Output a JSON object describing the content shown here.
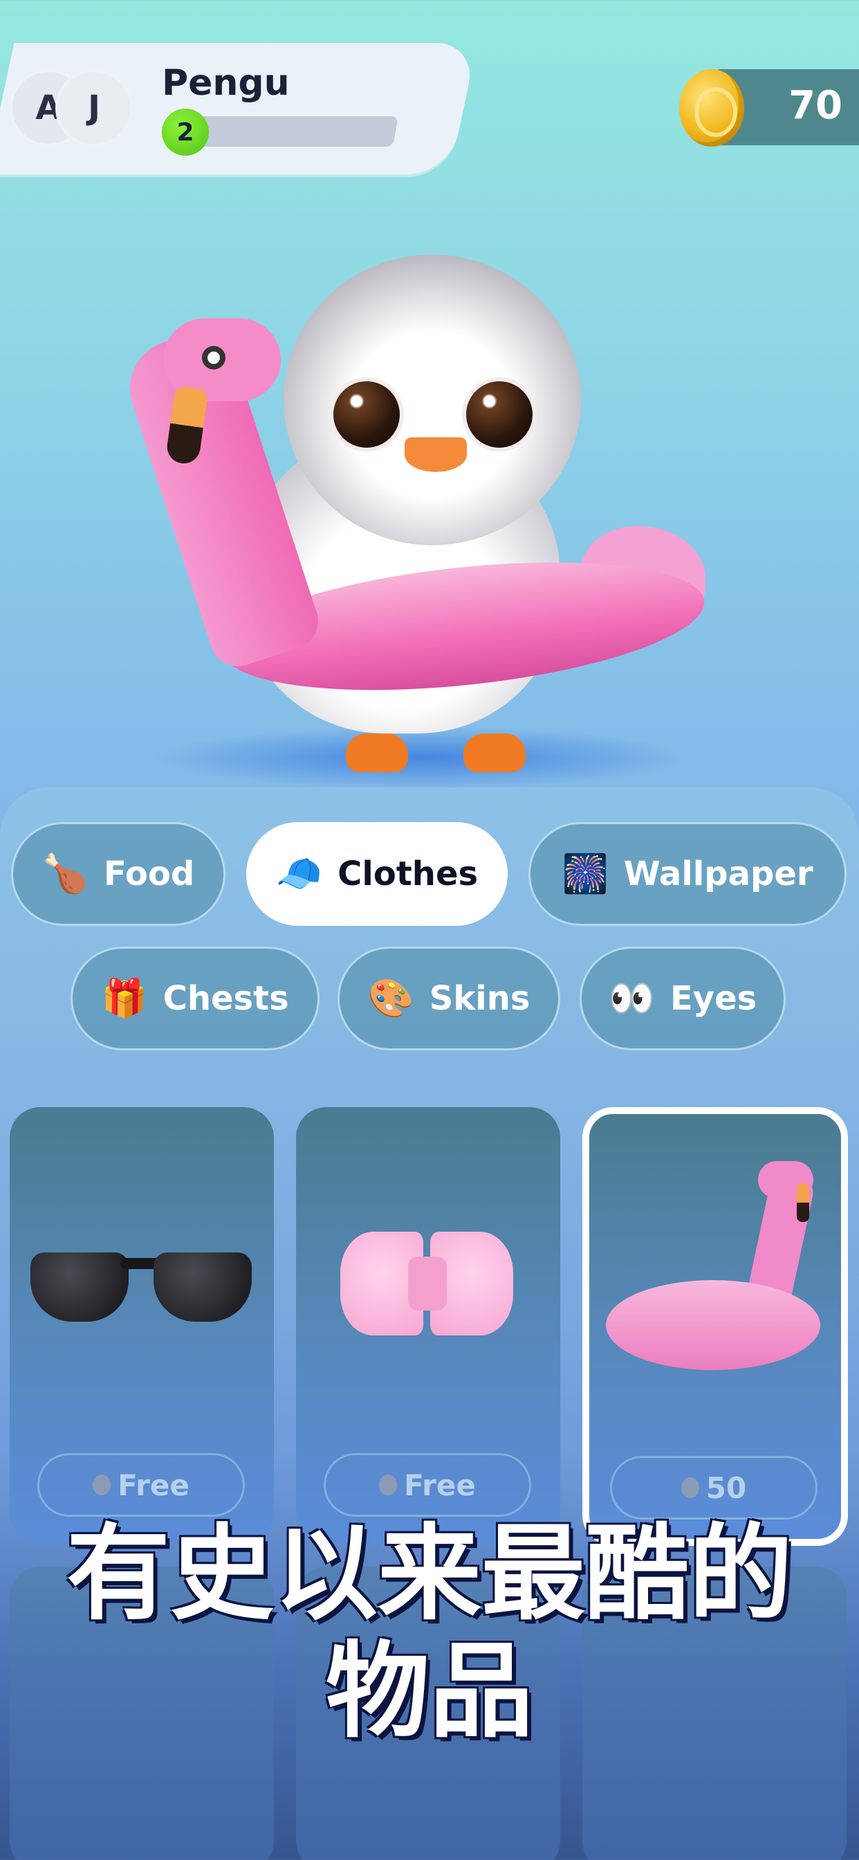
{
  "header": {
    "avatars": [
      "A",
      "J"
    ],
    "username": "Pengu",
    "level": "2",
    "xp_progress": 0.12,
    "coins": "70"
  },
  "categories": [
    {
      "label": "Food",
      "icon": "drumstick-icon",
      "glyph": "🍗",
      "active": false
    },
    {
      "label": "Clothes",
      "icon": "cap-icon",
      "glyph": "🧢",
      "active": true
    },
    {
      "label": "Wallpaper",
      "icon": "fireworks-icon",
      "glyph": "🎆",
      "active": false
    },
    {
      "label": "Chests",
      "icon": "gift-icon",
      "glyph": "🎁",
      "active": false
    },
    {
      "label": "Skins",
      "icon": "palette-icon",
      "glyph": "🎨",
      "active": false
    },
    {
      "label": "Eyes",
      "icon": "eyes-icon",
      "glyph": "👀",
      "active": false
    }
  ],
  "items": [
    {
      "name": "sunglasses",
      "price": "Free",
      "selected": false
    },
    {
      "name": "bow-tie",
      "price": "Free",
      "selected": false
    },
    {
      "name": "flamingo-float",
      "price": "50",
      "selected": true
    }
  ],
  "caption": "有史以来最酷的物品",
  "colors": {
    "accent_green": "#52c414",
    "active_chip": "#ffffff",
    "chip_bg": "#5c96b4",
    "caption_shadow": "#0b1340"
  }
}
